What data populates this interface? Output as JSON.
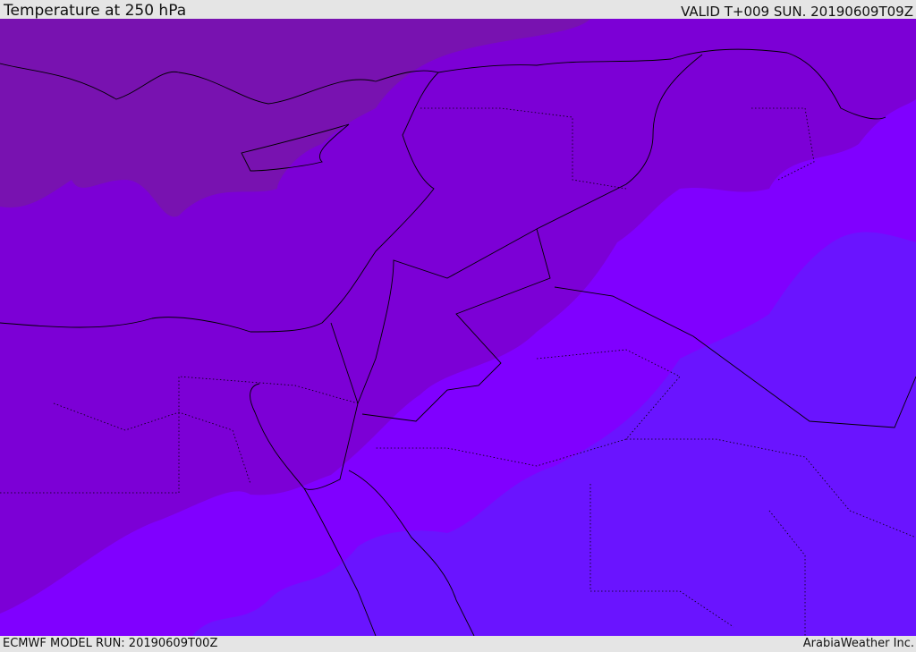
{
  "header": {
    "title": "Temperature at 250 hPa",
    "valid_time": "VALID T+009 SUN. 20190609T09Z"
  },
  "footer": {
    "model_run": "ECMWF MODEL RUN: 20190609T00Z",
    "credit": "ArabiaWeather Inc."
  },
  "map": {
    "field": "temperature",
    "level": "250 hPa",
    "colors": {
      "coldest_band": "#7812b0",
      "band_2": "#7c00d6",
      "band_3": "#8000ff",
      "warmest_band": "#6a14ff",
      "border_line": "#000000"
    }
  }
}
